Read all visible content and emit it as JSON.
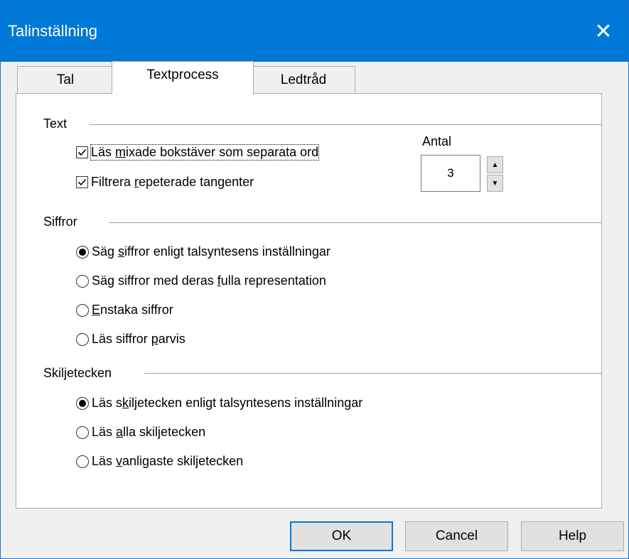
{
  "window": {
    "title": "Talinställning",
    "close_glyph": "✕"
  },
  "tabs": [
    {
      "label": "Tal",
      "active": false
    },
    {
      "label": "Textprocess",
      "active": true
    },
    {
      "label": "Ledtråd",
      "active": false
    }
  ],
  "text_group": {
    "label": "Text",
    "checkboxes": [
      {
        "pre": "Läs ",
        "mn": "m",
        "post": "ixade bokstäver som separata ord",
        "checked": true
      },
      {
        "pre": "Filtrera ",
        "mn": "r",
        "post": "epeterade tangenter",
        "checked": true
      }
    ],
    "count": {
      "label": "Antal",
      "value": "3"
    }
  },
  "digits_group": {
    "label": "Siffror",
    "radios": [
      {
        "pre": "Säg ",
        "mn": "s",
        "post": "iffror enligt talsyntesens inställningar",
        "selected": true
      },
      {
        "pre": "Säg siffror med deras ",
        "mn": "f",
        "post": "ulla representation",
        "selected": false
      },
      {
        "pre": "",
        "mn": "E",
        "post": "nstaka siffror",
        "selected": false
      },
      {
        "pre": "Läs siffror ",
        "mn": "p",
        "post": "arvis",
        "selected": false
      }
    ]
  },
  "punct_group": {
    "label": "Skiljetecken",
    "radios": [
      {
        "pre": "Läs s",
        "mn": "k",
        "post": "iljetecken enligt talsyntesens inställningar",
        "selected": true
      },
      {
        "pre": "Läs ",
        "mn": "a",
        "post": "lla skiljetecken",
        "selected": false
      },
      {
        "pre": "Läs ",
        "mn": "v",
        "post": "anligaste skiljetecken",
        "selected": false
      }
    ]
  },
  "buttons": {
    "ok": "OK",
    "cancel": "Cancel",
    "help": "Help"
  },
  "icons": {
    "spin_up": "▲",
    "spin_down": "▼"
  },
  "colors": {
    "titlebar": "#0078d7",
    "default_button_border": "#0078d7"
  }
}
